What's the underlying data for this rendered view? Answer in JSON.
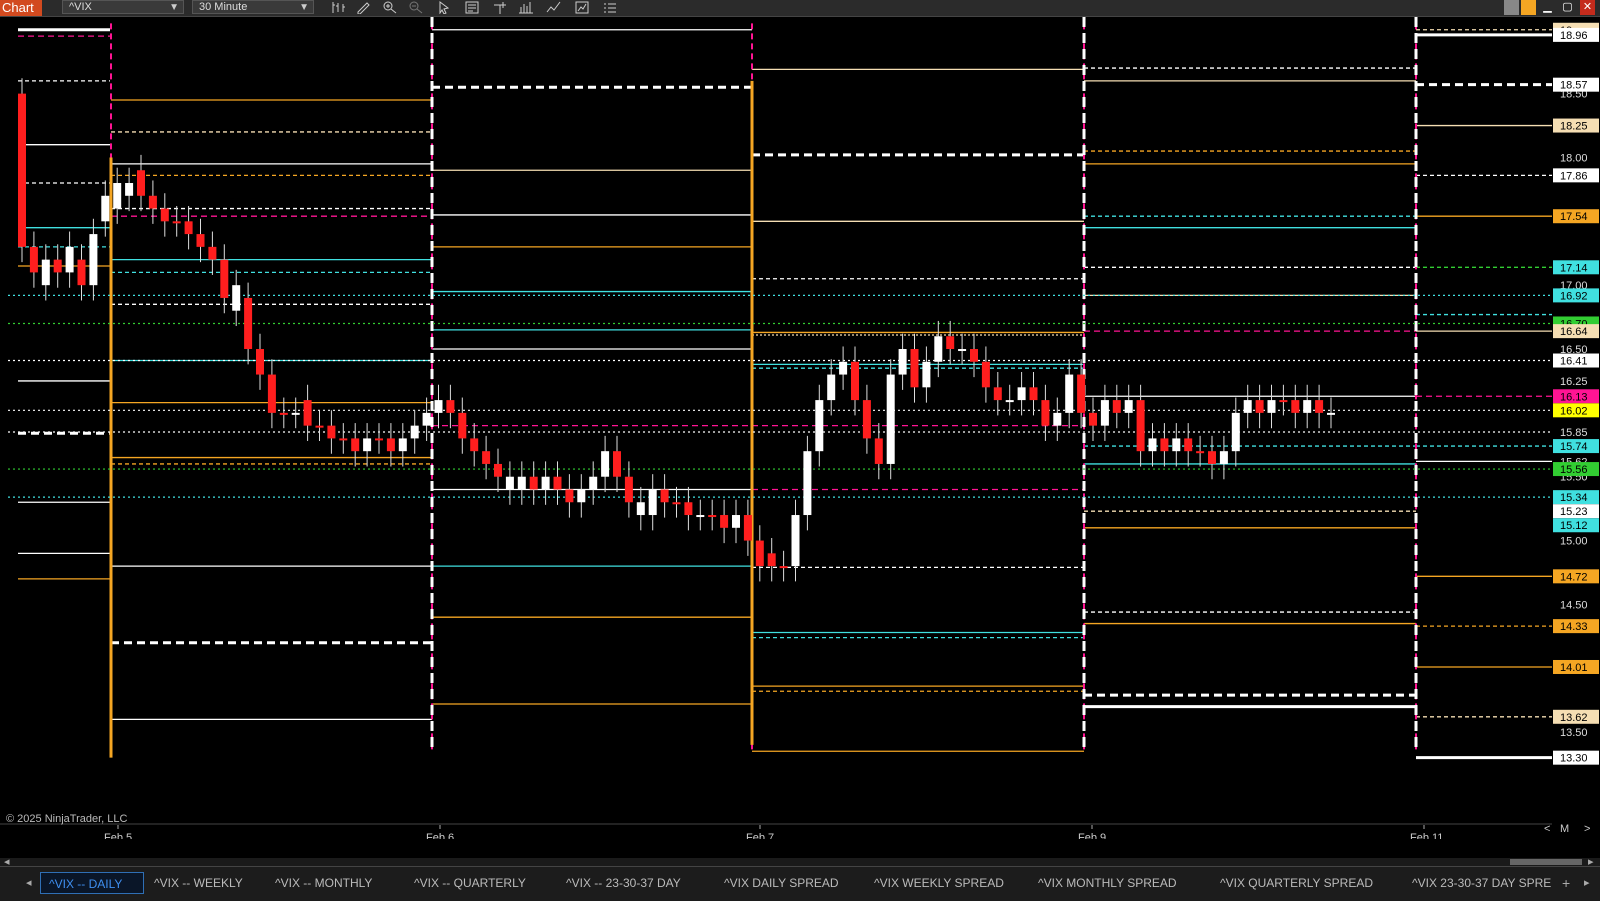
{
  "toolbar": {
    "app_title": "Chart",
    "instrument": "^VIX",
    "interval": "30 Minute",
    "icons": [
      "bar-type-icon",
      "pencil-icon",
      "zoom-in-icon",
      "zoom-out-icon",
      "pointer-icon",
      "data-box-icon",
      "crosshair-icon",
      "volume-icon",
      "indicators-icon",
      "strategies-icon",
      "list-icon"
    ]
  },
  "chart": {
    "copyright": "© 2025 NinjaTrader, LLC",
    "x_dates": [
      "Feb 5",
      "Feb 6",
      "Feb 7",
      "Feb 9",
      "Feb 11"
    ],
    "nav": {
      "prev": "<",
      "mode": "M",
      "next": ">"
    },
    "price_axis_labels": [
      "18.50",
      "18.00",
      "17.00",
      "16.50",
      "16.25",
      "15.85",
      "15.62",
      "15.50",
      "15.00",
      "14.50",
      "13.50",
      "16.70"
    ],
    "price_tags": [
      {
        "value": "19.",
        "color": "#f5deb3"
      },
      {
        "value": "18.96",
        "color": "#ffffff"
      },
      {
        "value": "18.57",
        "color": "#ffffff"
      },
      {
        "value": "18.25",
        "color": "#f5deb3"
      },
      {
        "value": "17.86",
        "color": "#ffffff"
      },
      {
        "value": "17.54",
        "color": "#f5a623"
      },
      {
        "value": "17.14",
        "color": "#40e0e0"
      },
      {
        "value": "16.92",
        "color": "#40e0e0"
      },
      {
        "value": "16.70",
        "color": "#32cd32"
      },
      {
        "value": "16.64",
        "color": "#f5deb3"
      },
      {
        "value": "16.41",
        "color": "#ffffff"
      },
      {
        "value": "16.13",
        "color": "#ff1493"
      },
      {
        "value": "16.02",
        "color": "#ffff00"
      },
      {
        "value": "15.74",
        "color": "#40e0e0"
      },
      {
        "value": "15.56",
        "color": "#32cd32"
      },
      {
        "value": "15.34",
        "color": "#40e0e0"
      },
      {
        "value": "15.23",
        "color": "#ffffff"
      },
      {
        "value": "15.12",
        "color": "#40e0e0"
      },
      {
        "value": "14.72",
        "color": "#f5a623"
      },
      {
        "value": "14.33",
        "color": "#f5a623"
      },
      {
        "value": "14.01",
        "color": "#f5a623"
      },
      {
        "value": "13.62",
        "color": "#f5deb3"
      },
      {
        "value": "13.30",
        "color": "#ffffff"
      }
    ],
    "pivot_colors": {
      "white": "#ffffff",
      "orange": "#f5a623",
      "cyan": "#40e0e0",
      "pink": "#ff1493",
      "wheat": "#f5deb3",
      "green": "#32cd32"
    },
    "candles": [
      [
        18.5,
        17.3
      ],
      [
        17.1,
        17.3,
        "r"
      ],
      [
        17.0,
        17.2,
        "w"
      ],
      [
        17.1,
        17.2,
        "r"
      ],
      [
        17.1,
        17.3,
        "w"
      ],
      [
        17.2,
        17.0,
        "r"
      ],
      [
        17.0,
        17.4,
        "w"
      ],
      [
        17.5,
        17.7,
        "w"
      ],
      [
        17.6,
        17.8,
        "w"
      ],
      [
        17.7,
        17.8,
        "w"
      ],
      [
        17.9,
        17.7,
        "r"
      ],
      [
        17.7,
        17.6,
        "r"
      ],
      [
        17.6,
        17.5,
        "r"
      ],
      [
        17.5,
        17.5,
        "r"
      ],
      [
        17.5,
        17.4,
        "r"
      ],
      [
        17.4,
        17.3,
        "r"
      ],
      [
        17.3,
        17.2,
        "r"
      ],
      [
        17.2,
        16.9,
        "r"
      ],
      [
        17.0,
        16.8,
        "w"
      ],
      [
        16.9,
        16.5,
        "r"
      ],
      [
        16.5,
        16.3,
        "r"
      ],
      [
        16.3,
        16.0,
        "r"
      ],
      [
        16.0,
        16.0,
        "r"
      ],
      [
        16.0,
        16.0,
        "w"
      ],
      [
        16.1,
        15.9,
        "r"
      ],
      [
        15.9,
        15.9,
        "r"
      ],
      [
        15.9,
        15.8,
        "r"
      ],
      [
        15.8,
        15.8,
        "r"
      ],
      [
        15.8,
        15.7,
        "r"
      ],
      [
        15.7,
        15.8,
        "w"
      ],
      [
        15.8,
        15.8,
        "r"
      ],
      [
        15.8,
        15.7,
        "r"
      ],
      [
        15.7,
        15.8,
        "w"
      ],
      [
        15.8,
        15.9,
        "w"
      ],
      [
        15.9,
        16.0,
        "w"
      ],
      [
        16.0,
        16.1,
        "w"
      ],
      [
        16.1,
        16.0,
        "r"
      ],
      [
        16.0,
        15.8,
        "r"
      ],
      [
        15.8,
        15.7,
        "r"
      ],
      [
        15.7,
        15.6,
        "r"
      ],
      [
        15.6,
        15.5,
        "r"
      ],
      [
        15.5,
        15.4,
        "w"
      ],
      [
        15.4,
        15.5,
        "w"
      ],
      [
        15.5,
        15.4,
        "r"
      ],
      [
        15.4,
        15.5,
        "w"
      ],
      [
        15.5,
        15.4,
        "r"
      ],
      [
        15.4,
        15.3,
        "r"
      ],
      [
        15.3,
        15.4,
        "w"
      ],
      [
        15.4,
        15.5,
        "w"
      ],
      [
        15.5,
        15.7,
        "w"
      ],
      [
        15.7,
        15.5,
        "r"
      ],
      [
        15.5,
        15.3,
        "r"
      ],
      [
        15.3,
        15.2,
        "w"
      ],
      [
        15.2,
        15.4,
        "w"
      ],
      [
        15.4,
        15.3,
        "r"
      ],
      [
        15.3,
        15.3,
        "r"
      ],
      [
        15.3,
        15.2,
        "r"
      ],
      [
        15.2,
        15.2,
        "w"
      ],
      [
        15.2,
        15.2,
        "r"
      ],
      [
        15.2,
        15.1,
        "r"
      ],
      [
        15.1,
        15.2,
        "w"
      ],
      [
        15.2,
        15.0,
        "r"
      ],
      [
        15.0,
        14.8,
        "r"
      ],
      [
        14.8,
        14.9,
        "r"
      ],
      [
        14.8,
        14.8,
        "r"
      ],
      [
        14.8,
        15.2,
        "w"
      ],
      [
        15.2,
        15.7,
        "w"
      ],
      [
        15.7,
        16.1,
        "w"
      ],
      [
        16.1,
        16.3,
        "w"
      ],
      [
        16.3,
        16.4,
        "w"
      ],
      [
        16.4,
        16.1,
        "r"
      ],
      [
        16.1,
        15.8,
        "r"
      ],
      [
        15.8,
        15.6,
        "r"
      ],
      [
        15.6,
        16.3,
        "w"
      ],
      [
        16.3,
        16.5,
        "w"
      ],
      [
        16.5,
        16.2,
        "r"
      ],
      [
        16.2,
        16.4,
        "w"
      ],
      [
        16.4,
        16.6,
        "w"
      ],
      [
        16.6,
        16.5,
        "r"
      ],
      [
        16.5,
        16.5,
        "w"
      ],
      [
        16.5,
        16.4,
        "r"
      ],
      [
        16.4,
        16.2,
        "r"
      ],
      [
        16.2,
        16.1,
        "r"
      ],
      [
        16.1,
        16.1,
        "w"
      ],
      [
        16.1,
        16.2,
        "w"
      ],
      [
        16.2,
        16.1,
        "r"
      ],
      [
        16.1,
        15.9,
        "r"
      ],
      [
        15.9,
        16.0,
        "w"
      ],
      [
        16.0,
        16.3,
        "w"
      ],
      [
        16.3,
        16.0,
        "r"
      ],
      [
        16.0,
        15.9,
        "r"
      ],
      [
        15.9,
        16.1,
        "w"
      ],
      [
        16.1,
        16.0,
        "r"
      ],
      [
        16.0,
        16.1,
        "w"
      ],
      [
        16.1,
        15.7,
        "r"
      ],
      [
        15.7,
        15.8,
        "w"
      ],
      [
        15.8,
        15.7,
        "r"
      ],
      [
        15.7,
        15.8,
        "w"
      ],
      [
        15.8,
        15.7,
        "r"
      ],
      [
        15.7,
        15.7,
        "r"
      ],
      [
        15.7,
        15.6,
        "r"
      ],
      [
        15.6,
        15.7,
        "w"
      ],
      [
        15.7,
        16.0,
        "w"
      ],
      [
        16.0,
        16.1,
        "w"
      ],
      [
        16.1,
        16.0,
        "r"
      ],
      [
        16.0,
        16.1,
        "w"
      ],
      [
        16.1,
        16.1,
        "r"
      ],
      [
        16.1,
        16.0,
        "r"
      ],
      [
        16.0,
        16.1,
        "w"
      ],
      [
        16.1,
        16.0,
        "r"
      ],
      [
        16.0,
        16.0,
        "w"
      ]
    ]
  },
  "tabs": [
    {
      "label": "^VIX -- DAILY",
      "active": true
    },
    {
      "label": "^VIX -- WEEKLY"
    },
    {
      "label": "^VIX -- MONTHLY"
    },
    {
      "label": "^VIX -- QUARTERLY"
    },
    {
      "label": "^VIX -- 23-30-37 DAY"
    },
    {
      "label": "^VIX DAILY SPREAD"
    },
    {
      "label": "^VIX WEEKLY SPREAD"
    },
    {
      "label": "^VIX MONTHLY SPREAD"
    },
    {
      "label": "^VIX QUARTERLY SPREAD"
    },
    {
      "label": "^VIX 23-30-37 DAY SPRE"
    }
  ],
  "tab_add": "+",
  "scroll": {
    "left": "◂",
    "right": "▸"
  }
}
